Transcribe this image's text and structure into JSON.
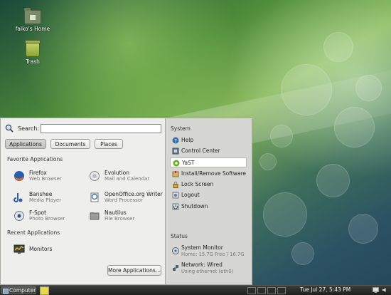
{
  "desktop": {
    "icons": [
      {
        "label": "falko's Home",
        "icon": "home-folder-icon"
      },
      {
        "label": "Trash",
        "icon": "trash-icon"
      }
    ]
  },
  "menu": {
    "search": {
      "label": "Search:",
      "value": ""
    },
    "tabs": [
      "Applications",
      "Documents",
      "Places"
    ],
    "active_tab": "Applications",
    "favorites_title": "Favorite Applications",
    "favorites": [
      {
        "name": "Firefox",
        "desc": "Web Browser",
        "icon": "firefox-icon"
      },
      {
        "name": "Evolution",
        "desc": "Mail and Calendar",
        "icon": "evolution-icon"
      },
      {
        "name": "Banshee",
        "desc": "Media Player",
        "icon": "banshee-icon"
      },
      {
        "name": "OpenOffice.org Writer",
        "desc": "Word Processor",
        "icon": "writer-icon"
      },
      {
        "name": "F-Spot",
        "desc": "Photo Browser",
        "icon": "fspot-icon"
      },
      {
        "name": "Nautilus",
        "desc": "File Browser",
        "icon": "nautilus-icon"
      }
    ],
    "recent_title": "Recent Applications",
    "recent": [
      {
        "name": "Monitors",
        "icon": "monitors-icon"
      }
    ],
    "more_button": "More Applications...",
    "system_title": "System",
    "system_items": [
      {
        "label": "Help",
        "icon": "help-icon"
      },
      {
        "label": "Control Center",
        "icon": "control-center-icon"
      },
      {
        "label": "YaST",
        "icon": "yast-icon"
      },
      {
        "label": "Install/Remove Software",
        "icon": "software-icon"
      },
      {
        "label": "Lock Screen",
        "icon": "lock-icon"
      },
      {
        "label": "Logout",
        "icon": "logout-icon"
      },
      {
        "label": "Shutdown",
        "icon": "shutdown-icon"
      }
    ],
    "selected_system_item": "YaST",
    "status_title": "Status",
    "status_items": [
      {
        "name": "System Monitor",
        "sub": "Home: 15.7G Free / 16.7G",
        "icon": "system-monitor-icon"
      },
      {
        "name": "Network: Wired",
        "sub": "Using ethernet (eth0)",
        "icon": "network-icon"
      }
    ]
  },
  "panel": {
    "computer_label": "Computer",
    "clock": "Tue Jul 27,  5:43 PM"
  },
  "colors": {
    "menu_bg": "#eeeeec",
    "menu_side_bg": "#d6d7d3",
    "panel_bg": "#2a2c2a",
    "desktop_green": "#6fa24a"
  }
}
